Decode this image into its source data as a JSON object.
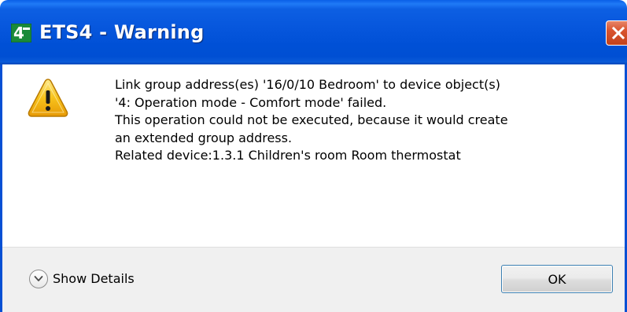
{
  "window": {
    "title": "ETS4 - Warning"
  },
  "message": {
    "lines": [
      "Link group address(es) '16/0/10 Bedroom' to device object(s)",
      "'4: Operation mode - Comfort mode' failed.",
      "This operation could not be executed, because it would create",
      "an extended group address.",
      "Related device:1.3.1  Children's room Room thermostat"
    ]
  },
  "footer": {
    "details_label": "Show Details",
    "ok_label": "OK"
  },
  "icons": {
    "app": "ets4-app-icon",
    "close": "close-icon",
    "warning": "warning-icon",
    "expand": "chevron-down-icon"
  },
  "colors": {
    "titlebar": "#0656dc",
    "close_button": "#d9532e",
    "warning_yellow": "#f7c21b",
    "footer_bg": "#f0f0f0",
    "ok_border": "#3c7fb1"
  }
}
